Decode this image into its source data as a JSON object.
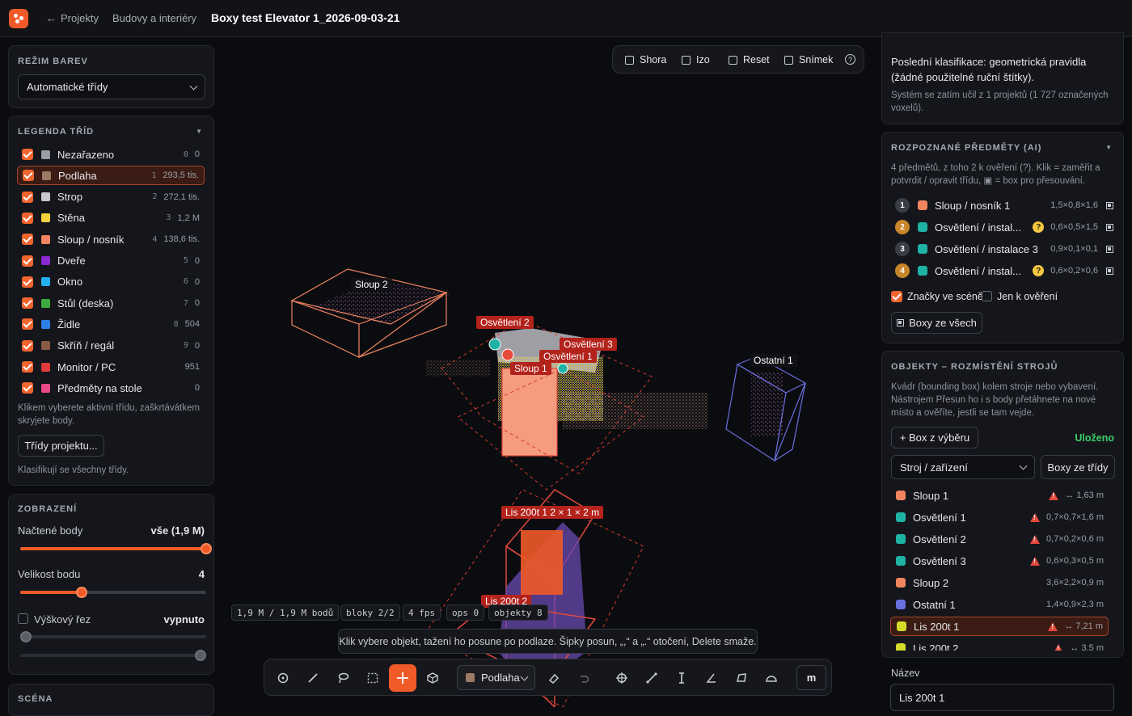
{
  "topbar": {
    "back_label": "Projekty",
    "breadcrumb": "Budovy a interiéry",
    "title": "Boxy test Elevator 1_2026-09-03-21"
  },
  "left": {
    "color_mode": {
      "heading": "REŽIM BAREV",
      "selected": "Automatické třídy"
    },
    "legend": {
      "heading": "LEGENDA TŘÍD",
      "items": [
        {
          "index": "0",
          "name": "Nezařazeno",
          "count": "0",
          "color": "#9a9ca3"
        },
        {
          "index": "1",
          "name": "Podlaha",
          "count": "293,5 tis.",
          "color": "#9c7a66"
        },
        {
          "index": "2",
          "name": "Strop",
          "count": "272,1 tis.",
          "color": "#c9c9cf"
        },
        {
          "index": "3",
          "name": "Stěna",
          "count": "1,2 M",
          "color": "#f3d23c"
        },
        {
          "index": "4",
          "name": "Sloup / nosník",
          "count": "138,6 tis.",
          "color": "#f28560"
        },
        {
          "index": "5",
          "name": "Dveře",
          "count": "0",
          "color": "#8a2ad0"
        },
        {
          "index": "6",
          "name": "Okno",
          "count": "0",
          "color": "#23aef0"
        },
        {
          "index": "7",
          "name": "Stůl (deska)",
          "count": "0",
          "color": "#3caa3c"
        },
        {
          "index": "8",
          "name": "Židle",
          "count": "504",
          "color": "#2f7fe8"
        },
        {
          "index": "9",
          "name": "Skříň / regál",
          "count": "0",
          "color": "#8a5a44"
        },
        {
          "index": "",
          "name": "Monitor / PC",
          "count": "951",
          "color": "#e33b3b"
        },
        {
          "index": "",
          "name": "Předměty na stole",
          "count": "0",
          "color": "#e84a88"
        }
      ],
      "hint": "Klikem vyberete aktivní třídu, zaškrtávátkem skryjete body.",
      "project_classes_button": "Třídy projektu...",
      "classify_note": "Klasifikují se všechny třídy."
    },
    "display": {
      "heading": "ZOBRAZENÍ",
      "loaded_label": "Načtené body",
      "loaded_value": "vše (1,9 M)",
      "loaded_fraction": 1.0,
      "point_size_label": "Velikost bodu",
      "point_size_value": "4",
      "point_size_fraction": 0.33,
      "height_cut_label": "Výškový řez",
      "height_cut_value": "vypnuto"
    },
    "scene_heading": "SCÉNA"
  },
  "viewport": {
    "view_buttons": [
      {
        "icon": "square-plus-icon",
        "label": "Shora"
      },
      {
        "icon": "cube-icon",
        "label": "Izo"
      },
      {
        "icon": "reset-icon",
        "label": "Reset"
      },
      {
        "icon": "camera-icon",
        "label": "Snímek"
      }
    ],
    "stats": [
      "1,9 M / 1,9 M bodů",
      "bloky 2/2",
      "4 fps",
      "ops 0",
      "objekty 8"
    ],
    "hint": "Klik vybere objekt, tažení ho posune po podlaze. Šipky posun, „,“ a „.“ otočení, Delete smaže.",
    "labels": {
      "sloup2": "Sloup 2",
      "osvetleni2": "Osvětlení 2",
      "osvetleni3": "Osvětlení 3",
      "osvetleni1": "Osvětlení 1",
      "sloup1": "Sloup 1",
      "ostatni1": "Ostatní 1",
      "lis1": "Lis 200t 1  2 × 1 × 2 m",
      "lis2": "Lis 200t 2"
    },
    "toolbar": {
      "class_select": "Podlaha",
      "class_color": "#9c7a66",
      "unit_button": "m"
    }
  },
  "right": {
    "last_classification": "Poslední klasifikace: geometrická pravidla (žádné použitelné ruční štítky).",
    "learned_note": "Systém se zatím učil z 1 projektů (1 727 označených voxelů).",
    "ai": {
      "heading": "ROZPOZNANÉ PŘEDMĚTY (AI)",
      "desc": "4 předmětů, z toho 2 k ověření (?). Klik = zaměřit a potvrdit / opravit třídu, ▣ = box pro přesouvání.",
      "items": [
        {
          "n": "1",
          "name": "Sloup / nosník 1",
          "dims": "1,5×0,8×1,6",
          "color": "#f28560",
          "badge": "#3a3d45",
          "question": false
        },
        {
          "n": "2",
          "name": "Osvětlení / instal...",
          "dims": "0,6×0,5×1,5",
          "color": "#1fb3a6",
          "badge": "#c8862a",
          "question": true
        },
        {
          "n": "3",
          "name": "Osvětlení / instalace 3",
          "dims": "0,9×0,1×0,1",
          "color": "#1fb3a6",
          "badge": "#3a3d45",
          "question": false
        },
        {
          "n": "4",
          "name": "Osvětlení / instal...",
          "dims": "0,6×0,2×0,6",
          "color": "#1fb3a6",
          "badge": "#c8862a",
          "question": true
        }
      ],
      "marks_label": "Značky ve scéně",
      "verify_only_label": "Jen k ověření",
      "boxes_all_button": "Boxy ze všech"
    },
    "objects": {
      "heading": "OBJEKTY – ROZMÍSTĚNÍ STROJŮ",
      "desc": "Kvádr (bounding box) kolem stroje nebo vybavení. Nástrojem Přesun ho i s body přetáhnete na nové místo a ověříte, jestli se tam vejde.",
      "add_button": "+ Box z výběru",
      "saved": "Uloženo",
      "type_select": "Stroj / zařízení",
      "boxes_from_class_button": "Boxy ze třídy",
      "items": [
        {
          "name": "Sloup 1",
          "dims": "↔ 1,63 m",
          "color": "#f28560",
          "warn": true
        },
        {
          "name": "Osvětlení 1",
          "dims": "0,7×0,7×1,6 m",
          "color": "#1fb3a6",
          "warn": true
        },
        {
          "name": "Osvětlení 2",
          "dims": "0,7×0,2×0,6 m",
          "color": "#1fb3a6",
          "warn": true
        },
        {
          "name": "Osvětlení 3",
          "dims": "0,6×0,3×0,5 m",
          "color": "#1fb3a6",
          "warn": true
        },
        {
          "name": "Sloup 2",
          "dims": "3,6×2,2×0,9 m",
          "color": "#f28560",
          "warn": false
        },
        {
          "name": "Ostatní 1",
          "dims": "1,4×0,9×2,3 m",
          "color": "#6a6fe0",
          "warn": false
        },
        {
          "name": "Lis 200t 1",
          "dims": "↔ 7,21 m",
          "color": "#d4dc2a",
          "warn": true
        },
        {
          "name": "Lis 200t 2",
          "dims": "↔ 3,5 m",
          "color": "#d4dc2a",
          "warn": true
        }
      ],
      "name_label": "Název",
      "name_value": "Lis 200t 1"
    }
  }
}
